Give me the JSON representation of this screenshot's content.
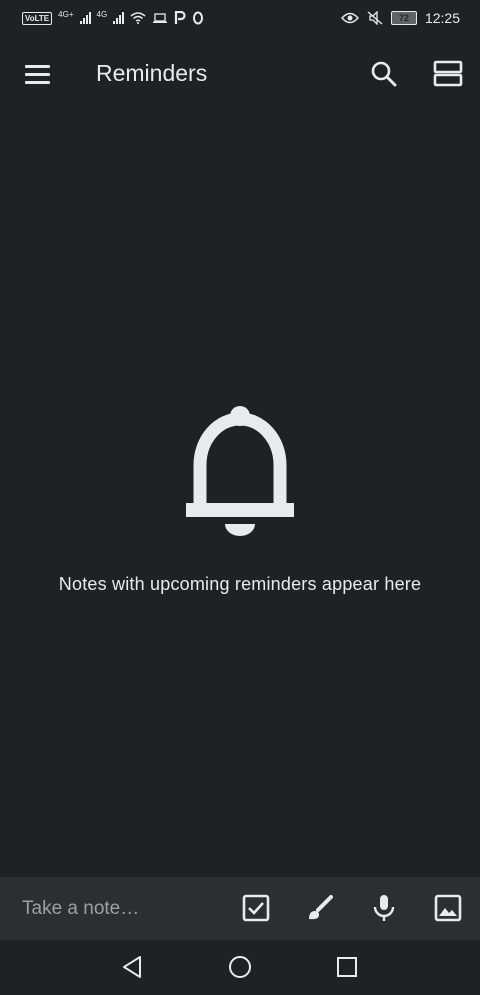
{
  "status_bar": {
    "volte": "VoLTE",
    "network_1": "4G+",
    "network_2": "4G",
    "battery": "72",
    "time": "12:25"
  },
  "app_bar": {
    "title": "Reminders",
    "icons": [
      "menu-icon",
      "search-icon",
      "list-view-icon"
    ]
  },
  "empty_state": {
    "icon": "bell-icon",
    "message": "Notes with upcoming reminders appear here"
  },
  "bottom_bar": {
    "placeholder": "Take a note…",
    "icons": [
      "checkbox-icon",
      "brush-icon",
      "microphone-icon",
      "image-icon"
    ]
  },
  "nav_bar": {
    "icons": [
      "back-icon",
      "home-icon",
      "recents-icon"
    ]
  },
  "colors": {
    "background": "#202124",
    "bottom_bar": "#2d2e31",
    "text": "#e8eaed",
    "placeholder": "#9aa0a6",
    "icon": "#e8eaed"
  }
}
